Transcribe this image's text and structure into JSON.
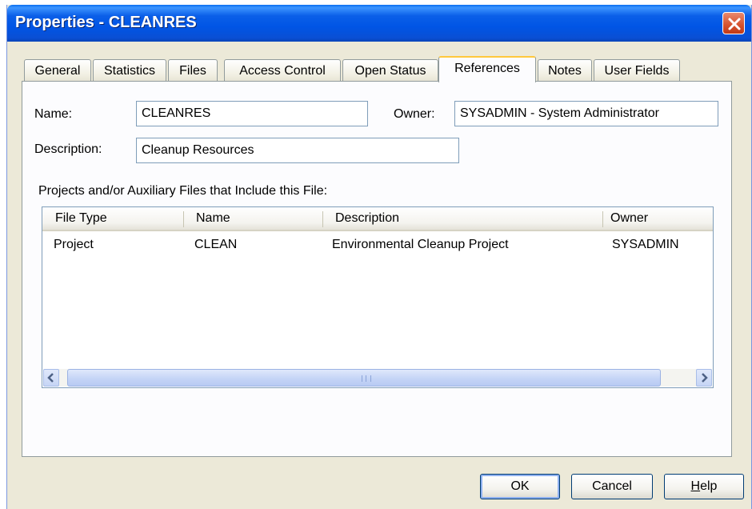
{
  "window": {
    "title": "Properties - CLEANRES",
    "close_icon": "close-icon"
  },
  "tabs": [
    {
      "label": "General"
    },
    {
      "label": "Statistics"
    },
    {
      "label": "Files"
    },
    {
      "label": "Access Control"
    },
    {
      "label": "Open Status"
    },
    {
      "label": "References",
      "active": true
    },
    {
      "label": "Notes"
    },
    {
      "label": "User Fields"
    }
  ],
  "form": {
    "name_label": "Name:",
    "name_value": "CLEANRES",
    "owner_label": "Owner:",
    "owner_value": "SYSADMIN - System Administrator",
    "description_label": "Description:",
    "description_value": "Cleanup Resources"
  },
  "list": {
    "caption": "Projects and/or Auxiliary Files that Include this File:",
    "columns": [
      "File Type",
      "Name",
      "Description",
      "Owner"
    ],
    "rows": [
      [
        "Project",
        "CLEAN",
        "Environmental Cleanup Project",
        "SYSADMIN"
      ]
    ]
  },
  "buttons": {
    "ok": "OK",
    "cancel": "Cancel",
    "help_prefix": "H",
    "help_rest": "elp"
  },
  "colors": {
    "title_bar": "#0055e5",
    "dialog_bg": "#ece9d8",
    "active_tab_highlight": "#ffc83c",
    "close_button": "#d5512c"
  }
}
